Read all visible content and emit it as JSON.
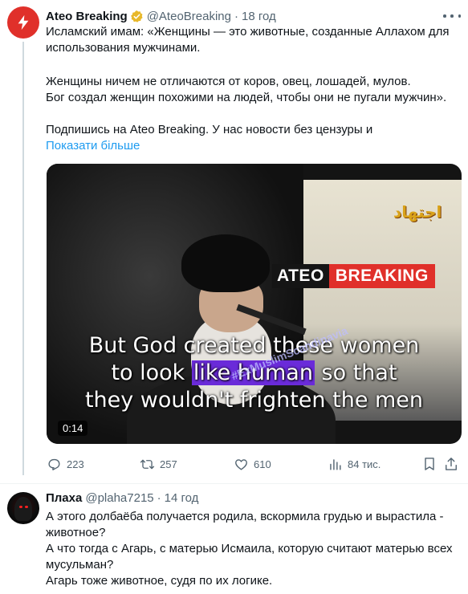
{
  "post": {
    "author_name": "Ateo Breaking",
    "author_handle": "@AteoBreaking",
    "separator": "·",
    "time": "18 год",
    "text_lines": [
      "Исламский имам: «Женщины — это животные, созданные Аллахом для",
      "использования мужчинами.",
      "Женщины ничем не отличаются от коров, овец, лошадей, мулов.",
      "Бог создал женщин похожими на людей, чтобы они не пугали мужчин».",
      "Подпишись на Ateo Breaking. У нас новости без цензуры и"
    ],
    "show_more": "Показати більше",
    "media": {
      "brand_left": "ATEO",
      "brand_right": "BREAKING",
      "channel_logo": "اجتهاد",
      "watermark": "#ExMuslimScandinavia",
      "subtitle_line1": "But God created these women",
      "subtitle_line2_pre": "to look ",
      "subtitle_line2_hl": "like human",
      "subtitle_line2_post": " so that",
      "subtitle_line3": "they wouldn't frighten the men",
      "duration": "0:14"
    },
    "actions": {
      "replies": "223",
      "reposts": "257",
      "likes": "610",
      "views": "84 тис."
    }
  },
  "reply": {
    "author_name": "Плаха",
    "author_handle": "@plaha7215",
    "separator": "·",
    "time": "14 год",
    "text_lines": [
      "А этого долбаёба получается родила,  вскормила грудью и вырастила -",
      "животное?",
      "А что тогда с Агарь, с матерью Исмаила, которую считают матерью всех",
      "мусульман?",
      "Агарь тоже животное, судя по их логике."
    ]
  },
  "colors": {
    "brand_red": "#e0302a",
    "link_blue": "#1d9bf0",
    "secondary_text": "#536471",
    "verified_gold": "#e8b829"
  },
  "icons": [
    "lightning-icon",
    "verified-icon",
    "more-icon",
    "reply-icon",
    "repost-icon",
    "like-icon",
    "views-icon",
    "bookmark-icon",
    "share-icon"
  ]
}
